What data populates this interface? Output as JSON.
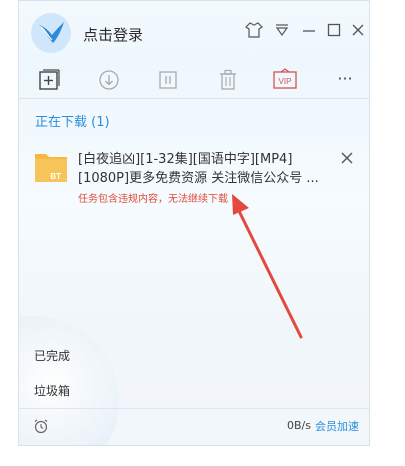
{
  "header": {
    "login_text": "点击登录"
  },
  "toolbar": {
    "buttons": [
      {
        "icon": "add-task-icon"
      },
      {
        "icon": "download-icon"
      },
      {
        "icon": "pause-icon"
      },
      {
        "icon": "trash-icon"
      },
      {
        "icon": "vip-icon",
        "label": "VIP"
      },
      {
        "icon": "more-icon",
        "label": "···"
      }
    ]
  },
  "downloading": {
    "section_title": "正在下载 (1)",
    "task": {
      "file_badge": "BT",
      "name": "[白夜追凶][1-32集][国语中字][MP4][1080P]更多免费资源 关注微信公众号 ...",
      "error": "任务包含违规内容，无法继续下载"
    }
  },
  "sidebar": {
    "completed": "已完成",
    "trash": "垃圾箱"
  },
  "status": {
    "speed": "0B/s",
    "member_boost": "会员加速"
  },
  "colors": {
    "accent": "#2a8fdc",
    "error": "#e04c3a",
    "vip": "#d9534f",
    "folder": "#f5b841"
  }
}
